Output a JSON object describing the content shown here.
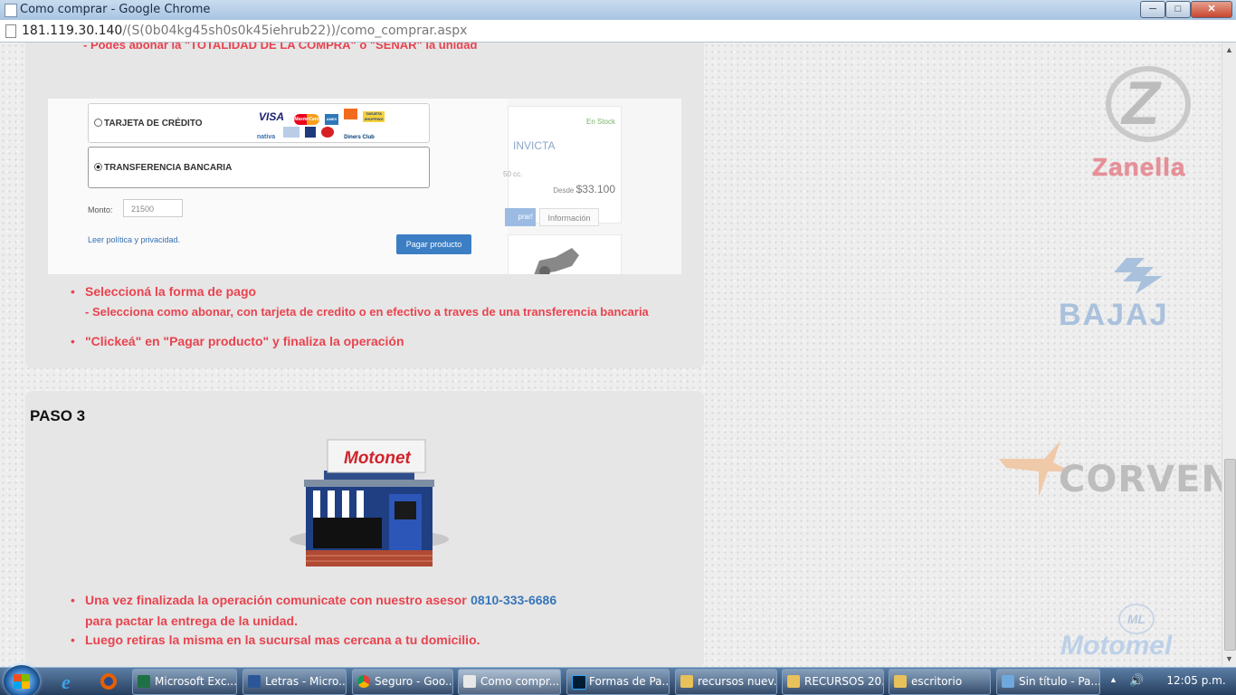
{
  "window": {
    "title": "Como comprar - Google Chrome",
    "minimize": "─",
    "maximize": "□",
    "close": "✕"
  },
  "address": {
    "host": "181.119.30.140",
    "path": "/(S(0b04kg45sh0s0k45iehrub22))/como_comprar.aspx"
  },
  "paso2": {
    "cut_text": "- Podés abonar la \"TOTALIDAD DE LA COMPRA\" o \"SEÑAR\" la unidad",
    "bullets": [
      {
        "title": "Seleccioná la forma de pago",
        "sub": "- Selecciona como abonar, con tarjeta de credito o en efectivo a traves de una transferencia bancaria"
      },
      {
        "title": "\"Clickeá\" en \"Pagar producto\" y finaliza la operación",
        "sub": ""
      }
    ]
  },
  "payment_screenshot": {
    "option_card": "TARJETA DE CRÉDITO",
    "option_transfer": "TRANSFERENCIA BANCARIA",
    "cards_row1": [
      "VISA",
      "MasterCard",
      "AMEX",
      "",
      "TARJETA SHOPPING"
    ],
    "cards_row2": [
      "nativa",
      "",
      "",
      "",
      "Diners Club"
    ],
    "monto_label": "Monto:",
    "monto_value": "21500",
    "policy_link": "Leer política y privacidad.",
    "pay_button": "Pagar producto",
    "stock": "En Stock",
    "product": "INVICTA",
    "cc": "50 cc.",
    "desde_label": "Desde",
    "price": "$33.100",
    "buy_button": "prar!",
    "info_button": "Información"
  },
  "paso3": {
    "title": "PASO 3",
    "store_sign": "Motonet",
    "bullet1_text": "Una vez finalizada la operación comunicate con nuestro asesor",
    "phone": "0810-333-6686",
    "bullet1_cont": "para pactar la entrega de la unidad.",
    "bullet2": "Luego retiras la misma en la sucursal mas cercana a tu domicilio."
  },
  "brands": {
    "zanella": "Zanella",
    "bajaj": "BAJAJ",
    "corven": "CORVEN",
    "motomel": "Motomel",
    "motomel_badge": "ML"
  },
  "taskbar": {
    "items": [
      {
        "label": "Microsoft Exc...",
        "icon_color": "#1e7145"
      },
      {
        "label": "Letras - Micro...",
        "icon_color": "#2b5797"
      },
      {
        "label": "Seguro - Goo...",
        "icon_color": "#dd4b39"
      },
      {
        "label": "Como compr...",
        "icon_color": "#e8e8e8"
      },
      {
        "label": "Formas de Pa...",
        "icon_color": "#001d34"
      },
      {
        "label": "recursos nuev...",
        "icon_color": "#e8c15a"
      },
      {
        "label": "RECURSOS 20...",
        "icon_color": "#e8c15a"
      },
      {
        "label": "escritorio",
        "icon_color": "#e8c15a"
      },
      {
        "label": "Sin título - Pa...",
        "icon_color": "#6fa8dc"
      }
    ],
    "tray_arrow": "▲",
    "volume": "🔊",
    "clock": "12:05 p.m."
  },
  "colors": {
    "accent_red": "#e8434f",
    "link_blue": "#3775b9",
    "panel_bg": "#e6e6e6"
  }
}
